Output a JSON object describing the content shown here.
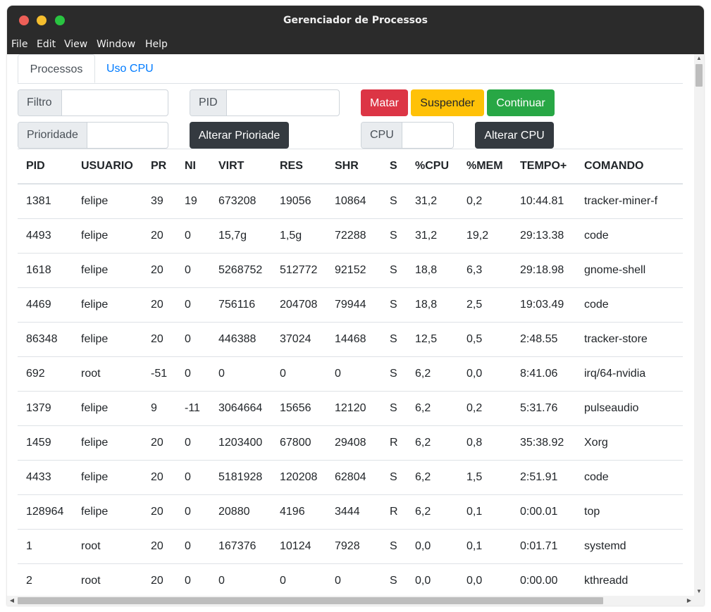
{
  "window": {
    "title": "Gerenciador de Processos"
  },
  "menu": [
    "File",
    "Edit",
    "View",
    "Window",
    "Help"
  ],
  "tabs": [
    {
      "label": "Processos",
      "active": true
    },
    {
      "label": "Uso CPU",
      "active": false
    }
  ],
  "filters": {
    "filtro": {
      "label": "Filtro",
      "value": ""
    },
    "pid": {
      "label": "PID",
      "value": ""
    },
    "prioridade": {
      "label": "Prioridade",
      "value": ""
    },
    "cpu": {
      "label": "CPU",
      "value": ""
    }
  },
  "buttons": {
    "matar": "Matar",
    "suspender": "Suspender",
    "continuar": "Continuar",
    "alterar_prioridade": "Alterar Prioriade",
    "alterar_cpu": "Alterar CPU"
  },
  "colors": {
    "danger": "#dc3545",
    "warning": "#ffc107",
    "success": "#28a745",
    "dark": "#343a40",
    "link": "#007bff"
  },
  "table": {
    "headers": [
      "PID",
      "USUARIO",
      "PR",
      "NI",
      "VIRT",
      "RES",
      "SHR",
      "S",
      "%CPU",
      "%MEM",
      "TEMPO+",
      "COMANDO"
    ],
    "rows": [
      [
        "1381",
        "felipe",
        "39",
        "19",
        "673208",
        "19056",
        "10864",
        "S",
        "31,2",
        "0,2",
        "10:44.81",
        "tracker-miner-f"
      ],
      [
        "4493",
        "felipe",
        "20",
        "0",
        "15,7g",
        "1,5g",
        "72288",
        "S",
        "31,2",
        "19,2",
        "29:13.38",
        "code"
      ],
      [
        "1618",
        "felipe",
        "20",
        "0",
        "5268752",
        "512772",
        "92152",
        "S",
        "18,8",
        "6,3",
        "29:18.98",
        "gnome-shell"
      ],
      [
        "4469",
        "felipe",
        "20",
        "0",
        "756116",
        "204708",
        "79944",
        "S",
        "18,8",
        "2,5",
        "19:03.49",
        "code"
      ],
      [
        "86348",
        "felipe",
        "20",
        "0",
        "446388",
        "37024",
        "14468",
        "S",
        "12,5",
        "0,5",
        "2:48.55",
        "tracker-store"
      ],
      [
        "692",
        "root",
        "-51",
        "0",
        "0",
        "0",
        "0",
        "S",
        "6,2",
        "0,0",
        "8:41.06",
        "irq/64-nvidia"
      ],
      [
        "1379",
        "felipe",
        "9",
        "-11",
        "3064664",
        "15656",
        "12120",
        "S",
        "6,2",
        "0,2",
        "5:31.76",
        "pulseaudio"
      ],
      [
        "1459",
        "felipe",
        "20",
        "0",
        "1203400",
        "67800",
        "29408",
        "R",
        "6,2",
        "0,8",
        "35:38.92",
        "Xorg"
      ],
      [
        "4433",
        "felipe",
        "20",
        "0",
        "5181928",
        "120208",
        "62804",
        "S",
        "6,2",
        "1,5",
        "2:51.91",
        "code"
      ],
      [
        "128964",
        "felipe",
        "20",
        "0",
        "20880",
        "4196",
        "3444",
        "R",
        "6,2",
        "0,1",
        "0:00.01",
        "top"
      ],
      [
        "1",
        "root",
        "20",
        "0",
        "167376",
        "10124",
        "7928",
        "S",
        "0,0",
        "0,1",
        "0:01.71",
        "systemd"
      ],
      [
        "2",
        "root",
        "20",
        "0",
        "0",
        "0",
        "0",
        "S",
        "0,0",
        "0,0",
        "0:00.00",
        "kthreadd"
      ]
    ]
  }
}
